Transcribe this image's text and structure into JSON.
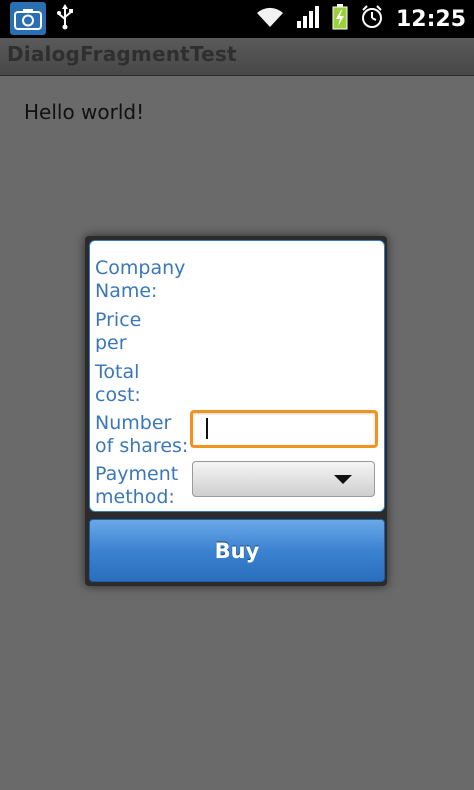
{
  "status_bar": {
    "time": "12:25",
    "icons": [
      "camera-icon",
      "usb-icon",
      "wifi-icon",
      "signal-icon",
      "battery-charging-icon",
      "alarm-icon"
    ]
  },
  "app": {
    "title": "DialogFragmentTest"
  },
  "main": {
    "hello_text": "Hello world!"
  },
  "dialog": {
    "company_label_1": "Company",
    "company_label_2": "Name:",
    "price_label_1": "Price",
    "price_label_2": "per",
    "total_label_1": "Total",
    "total_label_2": "cost:",
    "shares_label_1": "Number",
    "shares_label_2": "of shares:",
    "shares_value": "",
    "payment_label_1": "Payment",
    "payment_label_2": "method:",
    "payment_selected": "",
    "buy_label": "Buy"
  },
  "colors": {
    "label_blue": "#3a78b7",
    "focus_orange": "#f0941e",
    "button_blue": "#3b82d0"
  }
}
